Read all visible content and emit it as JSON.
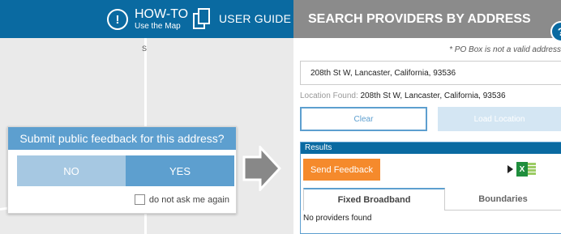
{
  "header": {
    "howto_title": "HOW-TO",
    "howto_sub": "Use the Map",
    "user_guide": "USER GUIDE"
  },
  "map": {
    "street_label": "S"
  },
  "feedback": {
    "title": "Submit public feedback for this address?",
    "no_label": "NO",
    "yes_label": "YES",
    "checkbox_label": "do not ask me again"
  },
  "panel": {
    "title": "SEARCH PROVIDERS BY ADDRESS",
    "help": "?",
    "po_note": "* PO Box is not a valid address",
    "address_value": "208th St W, Lancaster, California, 93536",
    "location_found_label": "Location Found:",
    "location_found_value": "208th St W, Lancaster, California, 93536",
    "clear_label": "Clear",
    "load_label": "Load Location"
  },
  "results": {
    "heading": "Results",
    "send_feedback": "Send Feedback",
    "excel_letter": "X",
    "tabs": [
      {
        "label": "Fixed Broadband"
      },
      {
        "label": "Boundaries"
      }
    ],
    "message": "No providers found"
  },
  "colors": {
    "header_blue": "#0a6aa1",
    "panel_gray": "#8b8b8b",
    "accent_blue": "#5d9fcf",
    "orange": "#f58a2c"
  }
}
